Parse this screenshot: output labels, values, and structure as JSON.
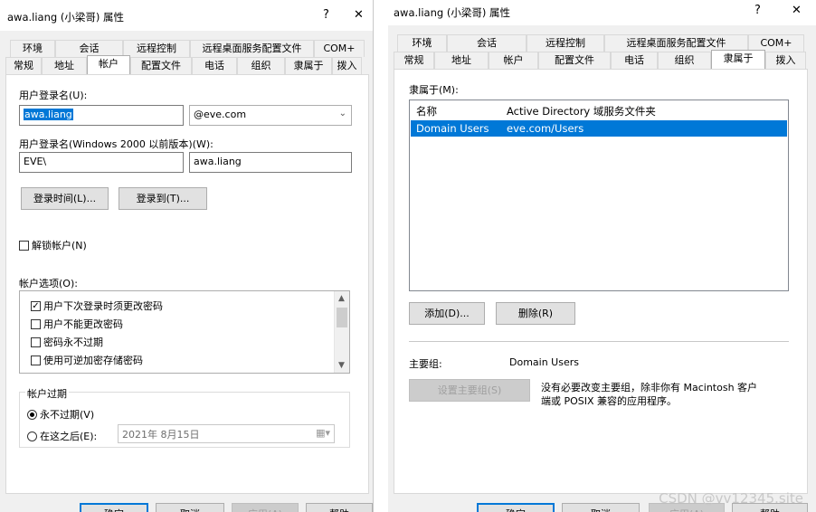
{
  "left_dialog": {
    "title": "awa.liang (小梁哥) 属性",
    "help_glyph": "?",
    "close_glyph": "✕",
    "tabs_back": [
      "环境",
      "会话",
      "远程控制",
      "远程桌面服务配置文件",
      "COM+"
    ],
    "tabs_front": [
      "常规",
      "地址",
      "帐户",
      "配置文件",
      "电话",
      "组织",
      "隶属于",
      "拨入"
    ],
    "active_tab": "帐户",
    "logon_name_label": "用户登录名(U):",
    "logon_name_value": "awa.liang",
    "domain_suffix": "@eve.com",
    "pre2000_label": "用户登录名(Windows 2000 以前版本)(W):",
    "pre2000_domain": "EVE\\",
    "pre2000_name": "awa.liang",
    "logon_hours_button": "登录时间(L)...",
    "logon_to_button": "登录到(T)...",
    "unlock_label": "解锁帐户(N)",
    "options_label": "帐户选项(O):",
    "options": [
      {
        "label": "用户下次登录时须更改密码",
        "checked": true
      },
      {
        "label": "用户不能更改密码",
        "checked": false
      },
      {
        "label": "密码永不过期",
        "checked": false
      },
      {
        "label": "使用可逆加密存储密码",
        "checked": false
      }
    ],
    "expiry_group": "帐户过期",
    "never_expires": "永不过期(V)",
    "end_of": "在这之后(E):",
    "expiry_date": "2021年  8月15日",
    "calendar_icon": "▦▾",
    "footer_buttons": [
      "确定",
      "取消",
      "应用(A)",
      "帮助"
    ]
  },
  "right_dialog": {
    "title": "awa.liang (小梁哥) 属性",
    "help_glyph": "?",
    "close_glyph": "✕",
    "tabs_back": [
      "环境",
      "会话",
      "远程控制",
      "远程桌面服务配置文件",
      "COM+"
    ],
    "tabs_front": [
      "常规",
      "地址",
      "帐户",
      "配置文件",
      "电话",
      "组织",
      "隶属于",
      "拨入"
    ],
    "active_tab": "隶属于",
    "member_of_label": "隶属于(M):",
    "columns": [
      "名称",
      "Active Directory 域服务文件夹"
    ],
    "rows": [
      {
        "name": "Domain Users",
        "folder": "eve.com/Users",
        "selected": true
      }
    ],
    "add_button": "添加(D)...",
    "remove_button": "删除(R)",
    "primary_group_label": "主要组:",
    "primary_group_value": "Domain Users",
    "set_primary_button": "设置主要组(S)",
    "primary_note_line1": "没有必要改变主要组，除非你有 Macintosh 客户",
    "primary_note_line2": "端或 POSIX 兼容的应用程序。",
    "footer_buttons": [
      "确定",
      "取消",
      "应用(A)",
      "帮助"
    ]
  },
  "watermark": "CSDN @vv12345.site",
  "colors": {
    "selection": "#0078d7",
    "dialog_bg": "#f0f0f0",
    "page_bg": "#ffffff"
  }
}
